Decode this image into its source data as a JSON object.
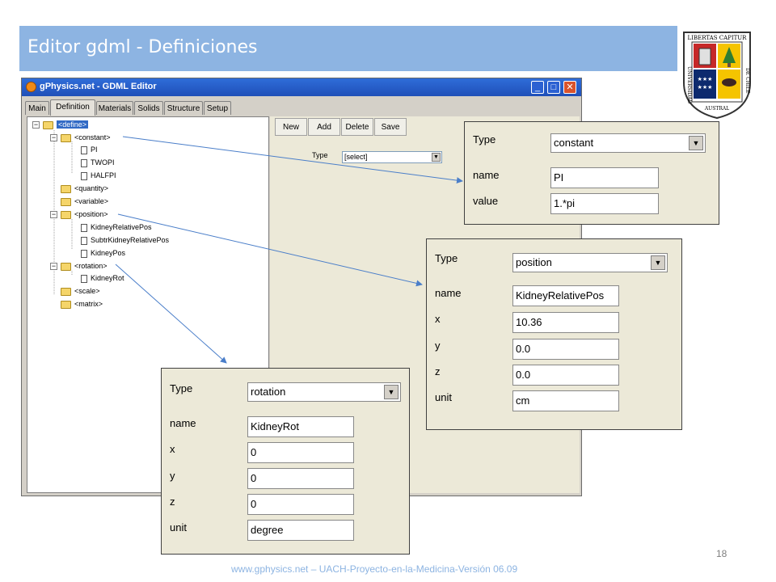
{
  "slide": {
    "title": "Editor gdml - Definiciones",
    "page_number": "18",
    "footer": "www.gphysics.net – UACH-Proyecto-en-la-Medicina-Versión 06.09"
  },
  "logo": {
    "top_text": "LIBERTAS CAPITUR",
    "side_left": "UNIVERSIDAD",
    "side_right": "DE CHILE",
    "bottom_text": "AUSTRAL"
  },
  "window": {
    "title": "gPhysics.net - GDML Editor",
    "tabs": [
      "Main",
      "Definition",
      "Materials",
      "Solids",
      "Structure",
      "Setup"
    ],
    "active_tab": "Definition",
    "tree": [
      {
        "label": "<define>",
        "level": 0,
        "kind": "folder",
        "selected": true
      },
      {
        "label": "<constant>",
        "level": 1,
        "kind": "folder"
      },
      {
        "label": "PI",
        "level": 2,
        "kind": "doc"
      },
      {
        "label": "TWOPI",
        "level": 2,
        "kind": "doc"
      },
      {
        "label": "HALFPI",
        "level": 2,
        "kind": "doc"
      },
      {
        "label": "<quantity>",
        "level": 1,
        "kind": "folder"
      },
      {
        "label": "<variable>",
        "level": 1,
        "kind": "folder"
      },
      {
        "label": "<position>",
        "level": 1,
        "kind": "folder"
      },
      {
        "label": "KidneyRelativePos",
        "level": 2,
        "kind": "doc"
      },
      {
        "label": "SubtrKidneyRelativePos",
        "level": 2,
        "kind": "doc"
      },
      {
        "label": "KidneyPos",
        "level": 2,
        "kind": "doc"
      },
      {
        "label": "<rotation>",
        "level": 1,
        "kind": "folder"
      },
      {
        "label": "KidneyRot",
        "level": 2,
        "kind": "doc"
      },
      {
        "label": "<scale>",
        "level": 1,
        "kind": "folder"
      },
      {
        "label": "<matrix>",
        "level": 1,
        "kind": "folder"
      }
    ],
    "toolbar": [
      "New",
      "Add",
      "Delete",
      "Save"
    ],
    "type_label": "Type",
    "type_value": "[select]"
  },
  "panels": {
    "constant": {
      "type_label": "Type",
      "type_value": "constant",
      "fields": [
        {
          "label": "name",
          "value": "PI"
        },
        {
          "label": "value",
          "value": "1.*pi"
        }
      ]
    },
    "position": {
      "type_label": "Type",
      "type_value": "position",
      "fields": [
        {
          "label": "name",
          "value": "KidneyRelativePos"
        },
        {
          "label": "x",
          "value": "10.36"
        },
        {
          "label": "y",
          "value": "0.0"
        },
        {
          "label": "z",
          "value": "0.0"
        },
        {
          "label": "unit",
          "value": "cm"
        }
      ]
    },
    "rotation": {
      "type_label": "Type",
      "type_value": "rotation",
      "fields": [
        {
          "label": "name",
          "value": "KidneyRot"
        },
        {
          "label": "x",
          "value": "0"
        },
        {
          "label": "y",
          "value": "0"
        },
        {
          "label": "z",
          "value": "0"
        },
        {
          "label": "unit",
          "value": "degree"
        }
      ]
    }
  },
  "colors": {
    "title_bar": "#8db4e2",
    "window_title": "#1f4fb8",
    "selection": "#316ac5",
    "arrow": "#4a7ec9"
  }
}
